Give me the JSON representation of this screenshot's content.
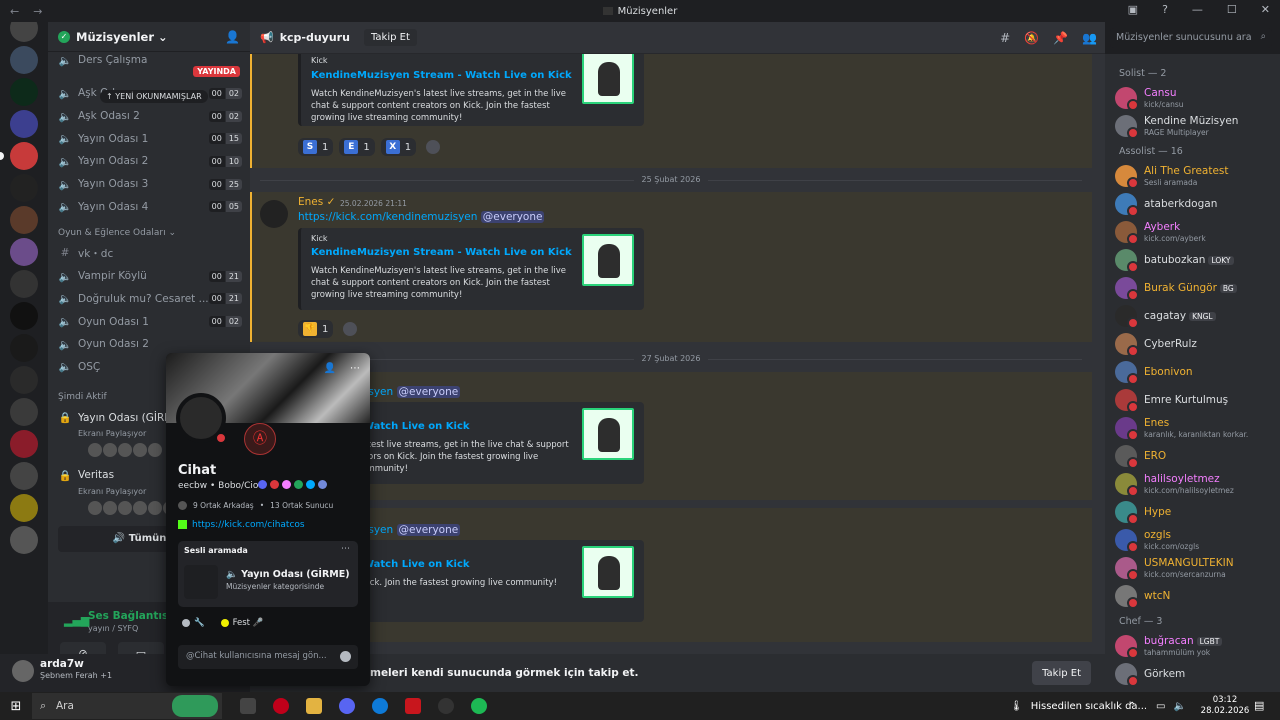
{
  "window": {
    "title": "Müzisyenler",
    "back": "←",
    "forward": "→"
  },
  "guild": {
    "name": "Müzisyenler"
  },
  "channel_list": {
    "unread_pill": "↑ YENİ OKUNMAMIŞLAR",
    "live_badge": "YAYINDA",
    "top_channel": "Ders Çalışma",
    "voice_channels": [
      {
        "name": "Aşk Odası",
        "c1": "00",
        "c2": "02"
      },
      {
        "name": "Aşk Odası 2",
        "c1": "00",
        "c2": "02"
      },
      {
        "name": "Yayın Odası 1",
        "c1": "00",
        "c2": "15"
      },
      {
        "name": "Yayın Odası 2",
        "c1": "00",
        "c2": "10"
      },
      {
        "name": "Yayın Odası 3",
        "c1": "00",
        "c2": "25"
      },
      {
        "name": "Yayın Odası 4",
        "c1": "00",
        "c2": "05"
      }
    ],
    "category_games": "Oyun & Eğlence Odaları",
    "game_channels": [
      {
        "name": "vk・dc",
        "c1": "",
        "c2": ""
      },
      {
        "name": "Vampir Köylü",
        "c1": "00",
        "c2": "21"
      },
      {
        "name": "Doğruluk mu? Cesaret ...",
        "c1": "00",
        "c2": "21"
      },
      {
        "name": "Oyun Odası 1",
        "c1": "00",
        "c2": "02"
      },
      {
        "name": "Oyun Odası 2",
        "c1": "",
        "c2": ""
      },
      {
        "name": "OSÇ",
        "c1": "",
        "c2": ""
      }
    ],
    "category_active": "Şimdi Aktif",
    "active": [
      {
        "name": "Yayın Odası (GİRME",
        "sub": "Ekranı Paylaşıyor"
      },
      {
        "name": "Veritas",
        "sub": "Ekranı Paylaşıyor"
      }
    ],
    "show_all": "Tümünü G"
  },
  "voice_status": {
    "connected": "Ses Bağlantısı Kuruldu",
    "sub": "yayın / SYFQ"
  },
  "user_panel": {
    "name": "arda7w",
    "song": "Şebnem Ferah +1"
  },
  "header": {
    "channel": "kcp-duyuru",
    "follow": "Takip Et",
    "search_placeholder": "Müzisyenler sunucusunu ara"
  },
  "messages": {
    "embed_provider": "Kick",
    "embed_title": "KendineMuzisyen Stream - Watch Live on Kick",
    "embed_desc": "Watch KendineMuzisyen's latest live streams, get in the live chat & support content creators on Kick. Join the fastest growing live streaming community!",
    "reactions_top": [
      {
        "letter": "S",
        "count": "1",
        "color": "#3b6fd4"
      },
      {
        "letter": "E",
        "count": "1",
        "color": "#3b6fd4"
      },
      {
        "letter": "X",
        "count": "1",
        "color": "#3b6fd4"
      }
    ],
    "date1": "25 Şubat 2026",
    "author": "Enes",
    "timestamp": "25.02.2026 21:11",
    "link": "https://kick.com/kendinemuzisyen",
    "link_partial": "/kendinemuzisyen",
    "mention": "@everyone",
    "reaction_mid_count": "1",
    "date2": "27 Şubat 2026",
    "embed_title_partial": "Stream - Watch Live on Kick",
    "embed_desc_partial": "Muzisyen's latest live streams, get in the live chat & support content creators on Kick. Join the fastest growing live streaming community!",
    "embed_desc_partial_short": "creators on Kick. Join the fastest growing live community!"
  },
  "follow_bar": {
    "text": "meleri kendi sunucunda görmek için takip et.",
    "button": "Takip Et"
  },
  "members": {
    "groups": [
      {
        "title": "Solist — 2",
        "members": [
          {
            "name": "Cansu",
            "status": "kick/cansu",
            "color": "#f47fff",
            "tag": ""
          },
          {
            "name": "Kendine Müzisyen",
            "status": "RAGE Multiplayer",
            "color": "#dbdee1",
            "tag": ""
          }
        ]
      },
      {
        "title": "Assolist — 16",
        "members": [
          {
            "name": "Ali The Greatest",
            "status": "Sesli aramada",
            "color": "#f0b232",
            "tag": ""
          },
          {
            "name": "ataberkdogan",
            "status": "",
            "color": "#dbdee1",
            "tag": ""
          },
          {
            "name": "Ayberk",
            "status": "kick.com/ayberk",
            "color": "#f47fff",
            "tag": ""
          },
          {
            "name": "batubozkan",
            "status": "",
            "color": "#dbdee1",
            "tag": "LOKY"
          },
          {
            "name": "Burak Güngör",
            "status": "",
            "color": "#f0b232",
            "tag": "BG"
          },
          {
            "name": "cagatay",
            "status": "",
            "color": "#dbdee1",
            "tag": "KNGL"
          },
          {
            "name": "CyberRulz",
            "status": "",
            "color": "#dbdee1",
            "tag": ""
          },
          {
            "name": "Ebonivon",
            "status": "",
            "color": "#f0b232",
            "tag": ""
          },
          {
            "name": "Emre Kurtulmuş",
            "status": "",
            "color": "#dbdee1",
            "tag": ""
          },
          {
            "name": "Enes",
            "status": "karanlık, karanlıktan korkar.",
            "color": "#f0b232",
            "tag": ""
          },
          {
            "name": "ERO",
            "status": "",
            "color": "#f0b232",
            "tag": ""
          },
          {
            "name": "halilsoyletmez",
            "status": "kick.com/halilsoyletmez",
            "color": "#f47fff",
            "tag": ""
          },
          {
            "name": "Hype",
            "status": "",
            "color": "#f0b232",
            "tag": ""
          },
          {
            "name": "ozgls",
            "status": "kick.com/ozgls",
            "color": "#f0b232",
            "tag": ""
          },
          {
            "name": "USMANGULTEKIN",
            "status": "kick.com/sercanzurna",
            "color": "#f0b232",
            "tag": ""
          },
          {
            "name": "wtcN",
            "status": "",
            "color": "#f0b232",
            "tag": ""
          }
        ]
      },
      {
        "title": "Chef — 3",
        "members": [
          {
            "name": "buğracan",
            "status": "tahammülüm yok",
            "color": "#f47fff",
            "tag": "LGBT"
          },
          {
            "name": "Görkem",
            "status": "",
            "color": "#dbdee1",
            "tag": ""
          }
        ]
      }
    ]
  },
  "profile_popout": {
    "name": "Cihat",
    "username": "eecbw",
    "pronoun": "Bobo/Cio",
    "mutual_friends": "9 Ortak Arkadaş",
    "mutual_servers": "13 Ortak Sunucu",
    "link": "https://kick.com/cihatcos",
    "voice_title": "Sesli aramada",
    "voice_channel": "Yayın Odası (GİRME)",
    "voice_category": "Müzisyenler kategorisinde",
    "status_2": "Fest",
    "message_placeholder": "@Cihat kullanıcısına mesaj gön..."
  },
  "taskbar": {
    "search": "Ara",
    "weather": "Hissedilen sıcaklık da...",
    "time": "03:12",
    "date": "28.02.2026"
  }
}
